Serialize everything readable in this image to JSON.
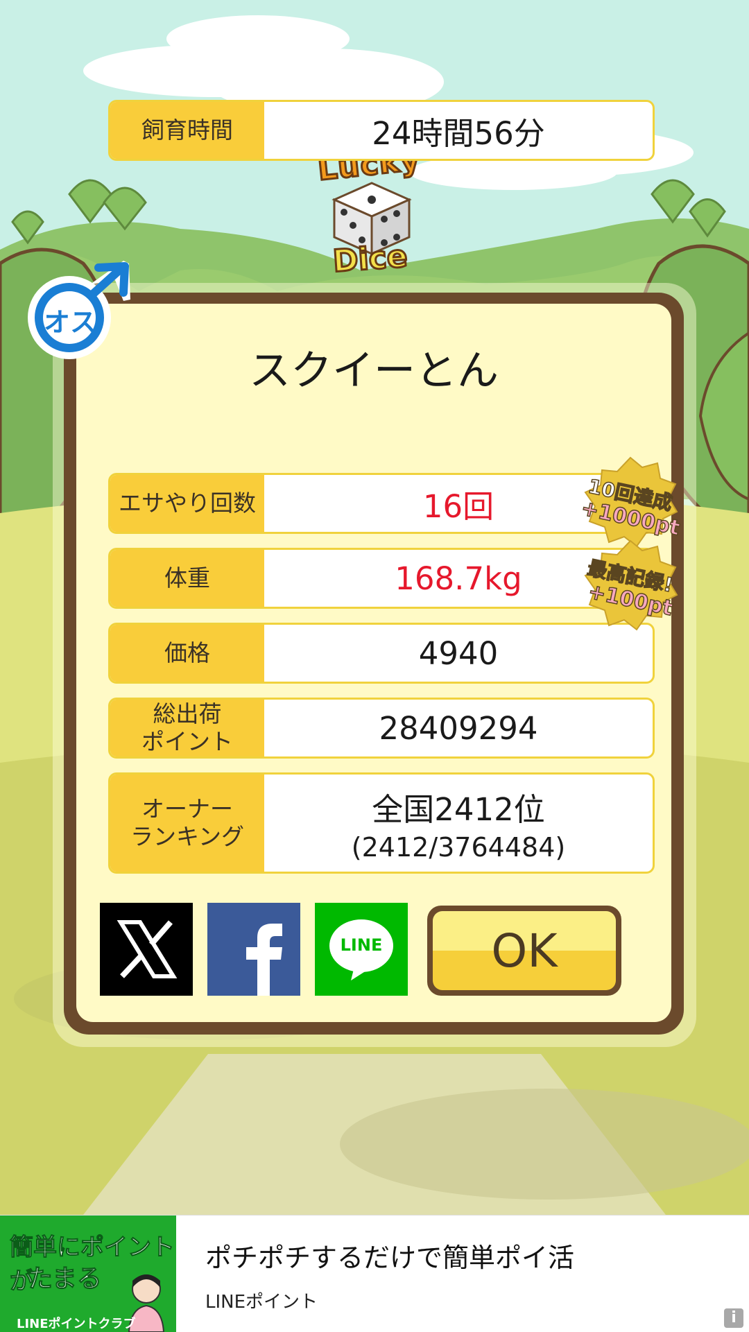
{
  "app": {
    "logo_top": "Lucky",
    "logo_bottom": "Dice",
    "gender_label": "オス"
  },
  "panel": {
    "title": "スクイーとん",
    "rows": [
      {
        "label": "飼育時間",
        "value": "24時間56分",
        "highlight": false
      },
      {
        "label": "エサやり回数",
        "value": "16回",
        "highlight": true
      },
      {
        "label": "体重",
        "value": "168.7kg",
        "highlight": true
      },
      {
        "label": "価格",
        "value": "4940",
        "highlight": false
      },
      {
        "label": "総出荷\nポイント",
        "value": "28409294",
        "highlight": false
      },
      {
        "label": "オーナー\nランキング",
        "value": "全国2412位",
        "value_sub": "(2412/3764484)",
        "highlight": false
      }
    ],
    "badges": [
      {
        "line1": "10回達成",
        "line2": "+1000pt"
      },
      {
        "line1": "最高記録!",
        "line2": "+100pt"
      }
    ],
    "share": {
      "x_icon": "x-logo-icon",
      "facebook_icon": "facebook-logo-icon",
      "line_label": "LINE"
    },
    "ok_label": "OK"
  },
  "ad": {
    "image_line1": "簡単にポイントが",
    "image_line2": "たまる",
    "image_footer": "LINEポイントクラブ",
    "title": "ポチポチするだけで簡単ポイ活",
    "source": "LINEポイント",
    "info_icon": "i"
  },
  "colors": {
    "panel_border": "#6b4a2c",
    "panel_bg": "#fffac6",
    "label_bg": "#f9cd3a",
    "highlight_text": "#e6182c",
    "ok_button": "#f6cf3a",
    "gender_blue": "#1a7ed4"
  }
}
